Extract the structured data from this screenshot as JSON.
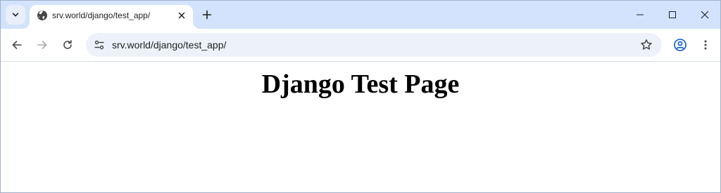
{
  "browser": {
    "tab": {
      "title": "srv.world/django/test_app/"
    },
    "address_bar": {
      "url": "srv.world/django/test_app/"
    },
    "icons": {
      "tab_search": "chevron-down-icon",
      "favicon": "globe-icon",
      "tab_close": "close-icon",
      "new_tab": "plus-icon",
      "back": "arrow-left-icon",
      "forward": "arrow-right-icon",
      "reload": "reload-icon",
      "site_info": "tune-icon",
      "bookmark": "star-icon",
      "profile": "account-icon",
      "menu": "kebab-menu-icon",
      "minimize": "minimize-icon",
      "maximize": "maximize-icon",
      "close_window": "close-icon"
    },
    "colors": {
      "tabstrip": "#d3e3fd",
      "omnibox": "#edf2fa",
      "icon": "#474747"
    }
  },
  "page": {
    "heading": "Django Test Page"
  }
}
